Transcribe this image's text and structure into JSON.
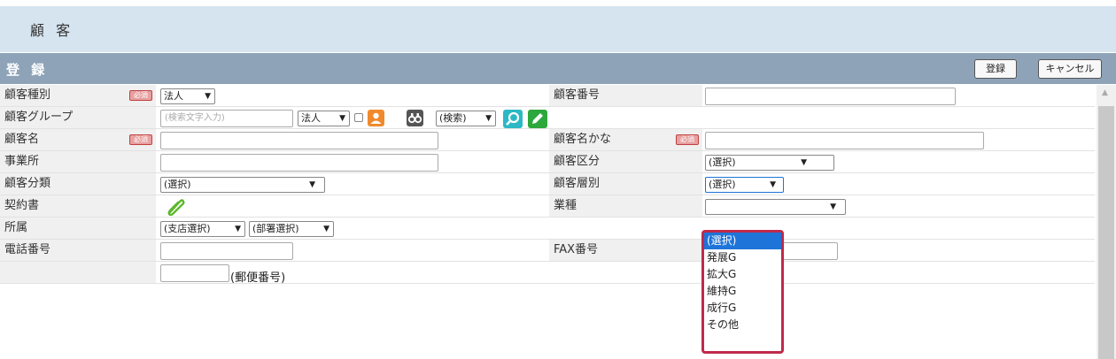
{
  "page_title": "顧 客",
  "section": {
    "title": "登 録",
    "register_button": "登録",
    "cancel_button": "キャンセル"
  },
  "required_badge": "必須",
  "rows": {
    "customer_type": {
      "label": "顧客種別",
      "value": "法人"
    },
    "customer_number": {
      "label": "顧客番号"
    },
    "customer_group": {
      "label": "顧客グループ",
      "placeholder": "(検索文字入力)",
      "type_value": "法人",
      "search_value": "(検索)"
    },
    "customer_name": {
      "label": "顧客名"
    },
    "customer_kana": {
      "label": "顧客名かな"
    },
    "office": {
      "label": "事業所"
    },
    "customer_division": {
      "label": "顧客区分",
      "value": "(選択)"
    },
    "customer_category": {
      "label": "顧客分類",
      "value": "(選択)"
    },
    "customer_tier": {
      "label": "顧客層別",
      "value": "(選択)"
    },
    "contract": {
      "label": "契約書"
    },
    "industry": {
      "label": "業種"
    },
    "affiliation": {
      "label": "所属",
      "branch_value": "(支店選択)",
      "dept_value": "(部署選択)"
    },
    "phone": {
      "label": "電話番号"
    },
    "fax": {
      "label": "FAX番号"
    },
    "postal": {
      "suffix": "(郵便番号)"
    }
  },
  "tier_dropdown": {
    "options": [
      "(選択)",
      "発展G",
      "拡大G",
      "維持G",
      "成行G",
      "その他"
    ],
    "selected": "(選択)"
  },
  "colors": {
    "header_bg": "#d6e4f0",
    "section_bg": "#8ea3b8",
    "dropdown_border": "#c0294a",
    "selected_bg": "#1e74d8"
  }
}
